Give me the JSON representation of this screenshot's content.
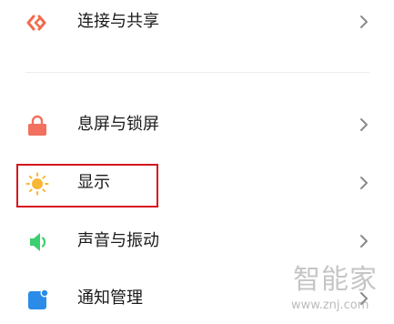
{
  "settings": {
    "items": [
      {
        "label": "连接与共享",
        "icon": "connection-share-icon",
        "color": "#f26b4b"
      },
      {
        "label": "息屏与锁屏",
        "icon": "lock-icon",
        "color": "#f2705e"
      },
      {
        "label": "显示",
        "icon": "sun-icon",
        "color": "#f7b733"
      },
      {
        "label": "声音与振动",
        "icon": "speaker-icon",
        "color": "#3ccf6f"
      },
      {
        "label": "通知管理",
        "icon": "notification-icon",
        "color": "#2a8ce8"
      }
    ]
  },
  "highlight": {
    "target": "显示",
    "color": "#d7141c"
  },
  "watermark": {
    "title": "智能家",
    "url": "www.znj.com"
  }
}
